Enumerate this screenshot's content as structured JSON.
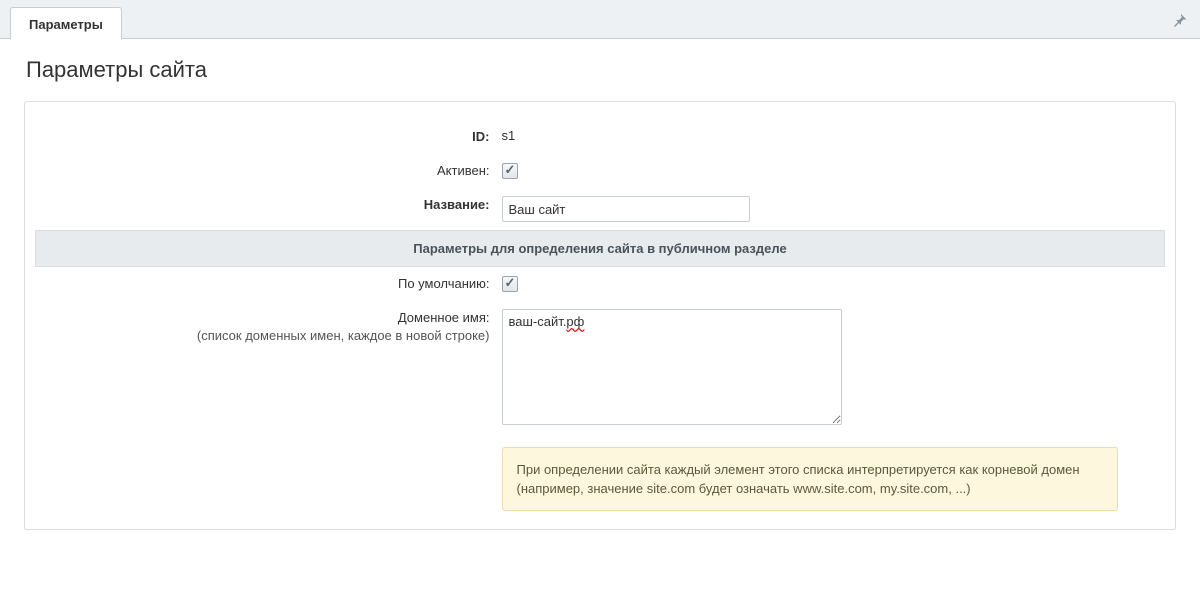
{
  "tabs": {
    "parameters": "Параметры"
  },
  "page_title": "Параметры сайта",
  "fields": {
    "id_label": "ID:",
    "id_value": "s1",
    "active_label": "Активен:",
    "active_checked": true,
    "name_label": "Название:",
    "name_value": "Ваш сайт",
    "section_public": "Параметры для определения сайта в публичном разделе",
    "default_label": "По умолчанию:",
    "default_checked": true,
    "domain_label": "Доменное имя:",
    "domain_sublabel": "(список доменных имен, каждое в новой строке)",
    "domain_value": "ваш-сайт.рф",
    "domain_hint": "При определении сайта каждый элемент этого списка интерпретируется как корневой домен (например, значение site.com будет означать www.site.com, my.site.com, ...)"
  }
}
